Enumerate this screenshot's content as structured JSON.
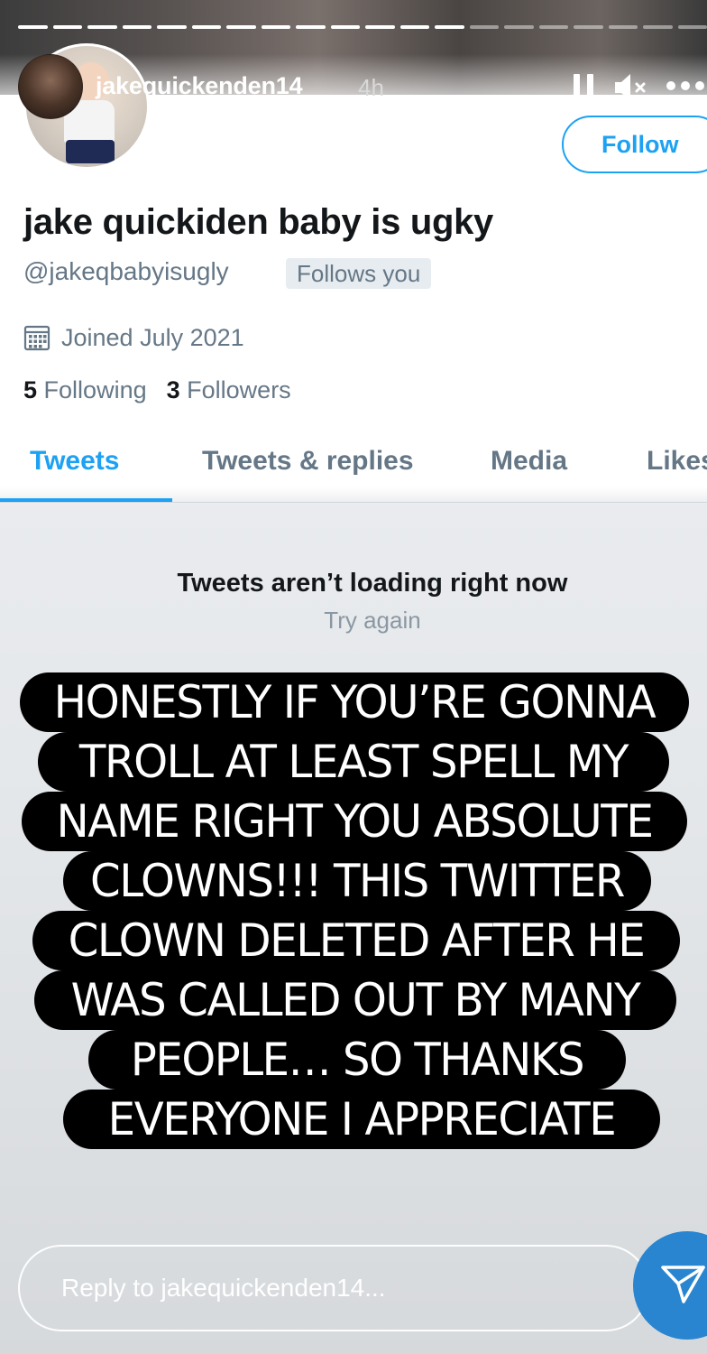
{
  "story": {
    "username": "jakequickenden14",
    "time": "4h",
    "progress_segments": 20,
    "progress_active": 13,
    "reply_placeholder": "Reply to jakequickenden14...",
    "caption_lines": [
      "HONESTLY IF YOU’RE GONNA",
      "TROLL AT LEAST SPELL MY",
      "NAME RIGHT YOU ABSOLUTE",
      "CLOWNS!!! THIS TWITTER",
      "CLOWN DELETED AFTER HE",
      "WAS CALLED OUT BY MANY",
      "PEOPLE… SO THANKS",
      "EVERYONE I APPRECIATE"
    ],
    "icons": {
      "pause": "pause-icon",
      "mute": "speaker-muted-icon",
      "more": "more-dots-icon",
      "send": "send-paper-plane-icon"
    }
  },
  "profile": {
    "display_name": "jake quickiden baby is ugky",
    "handle": "@jakeqbabyisugly",
    "follows_you": "Follows you",
    "follow_label": "Follow",
    "joined": "Joined July 2021",
    "following_count": "5",
    "following_label": "Following",
    "followers_count": "3",
    "followers_label": "Followers",
    "calendar_icon": "calendar-icon"
  },
  "tabs": [
    {
      "label": "Tweets",
      "active": true
    },
    {
      "label": "Tweets & replies",
      "active": false
    },
    {
      "label": "Media",
      "active": false
    },
    {
      "label": "Likes",
      "active": false
    }
  ],
  "error": {
    "title": "Tweets aren’t loading right now",
    "retry": "Try again"
  },
  "colors": {
    "twitter_blue": "#1da1f2",
    "send_button": "#2a85d0",
    "caption_bg": "#000000"
  }
}
